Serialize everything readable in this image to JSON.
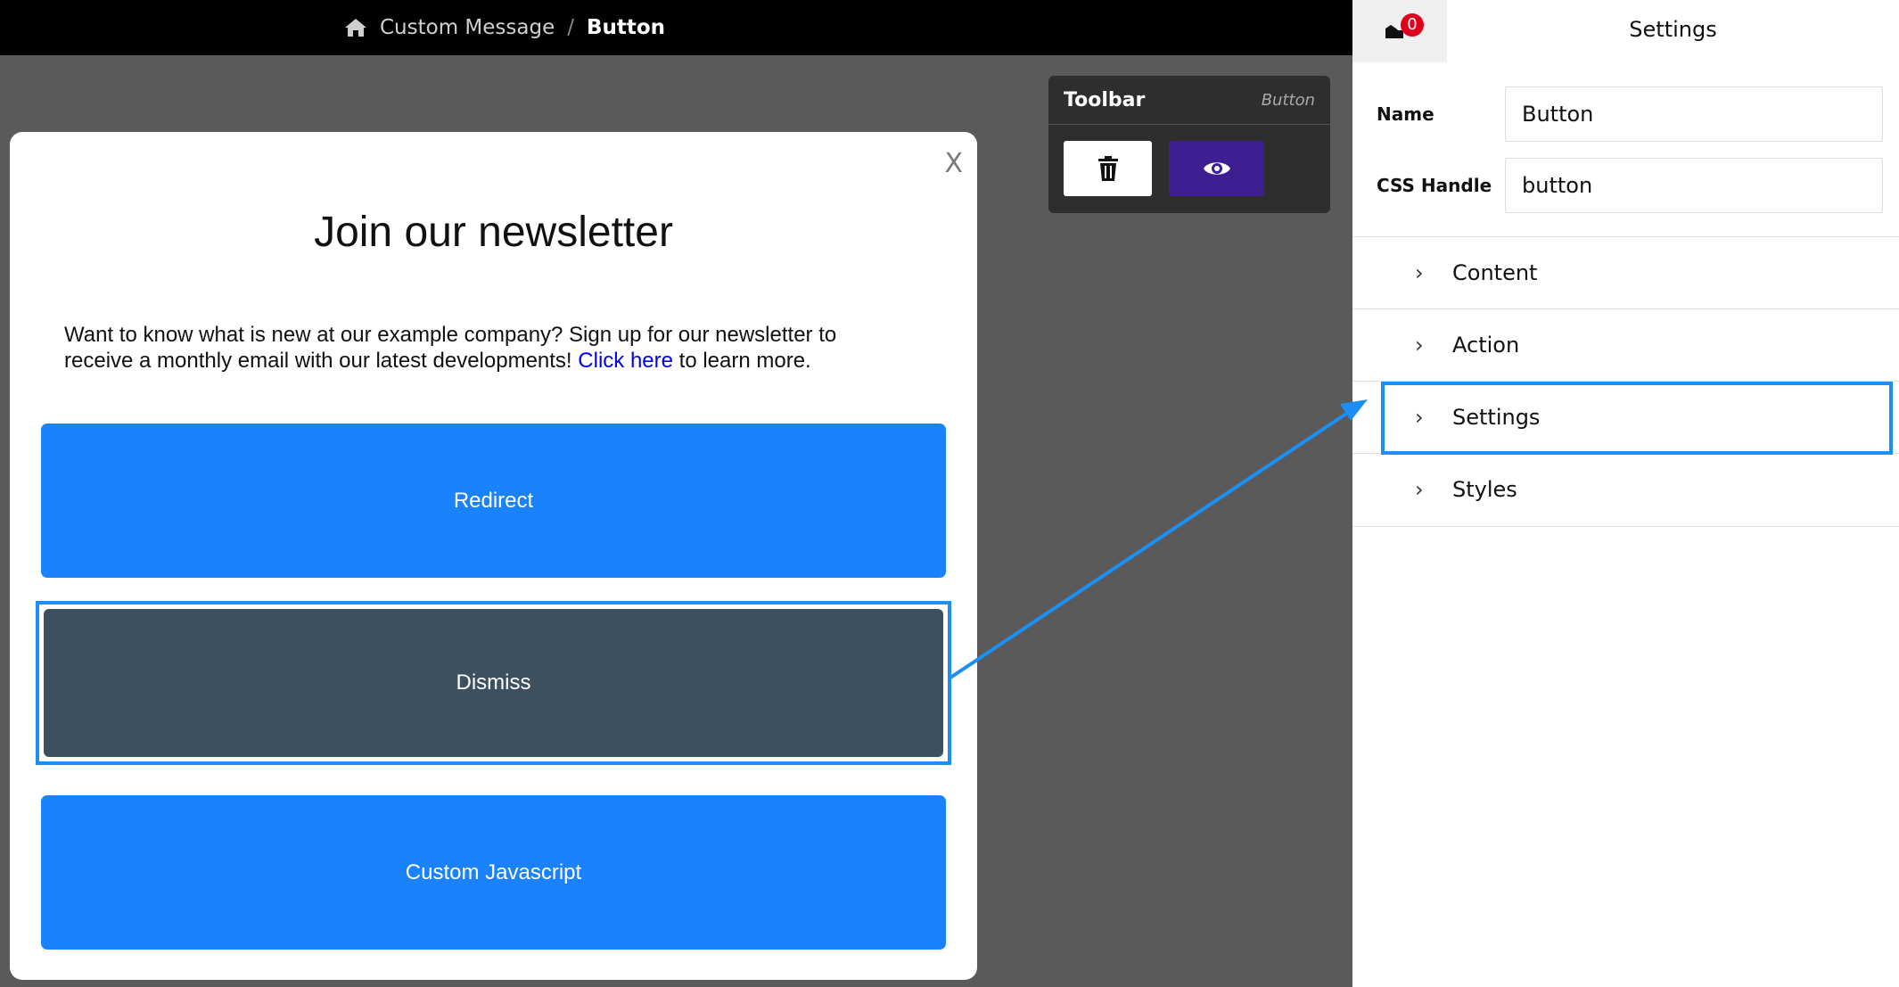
{
  "breadcrumb": {
    "home_icon": "home-icon",
    "parent": "Custom Message",
    "separator": "/",
    "current": "Button"
  },
  "modal": {
    "close_label": "X",
    "title": "Join our newsletter",
    "body_text": "Want to know what is new at our example company? Sign up for our newsletter to receive a monthly email with our latest developments!",
    "link_text": "Click here",
    "body_suffix": "to learn more.",
    "buttons": {
      "redirect": "Redirect",
      "dismiss": "Dismiss",
      "custom_js": "Custom Javascript"
    }
  },
  "toolbar": {
    "title": "Toolbar",
    "subtitle": "Button",
    "delete_icon": "trash-icon",
    "preview_icon": "eye-icon"
  },
  "panel": {
    "badge_count": "0",
    "title": "Settings",
    "name_label": "Name",
    "name_value": "Button",
    "css_label": "CSS Handle",
    "css_value": "button",
    "sections": [
      "Content",
      "Action",
      "Settings",
      "Styles"
    ],
    "highlighted_section": "Settings"
  },
  "colors": {
    "primary_button": "#1a82fb",
    "dismiss_button": "#3d5060",
    "highlight": "#1d8ef2",
    "preview_button": "#3d1f91",
    "badge": "#e0001b"
  }
}
